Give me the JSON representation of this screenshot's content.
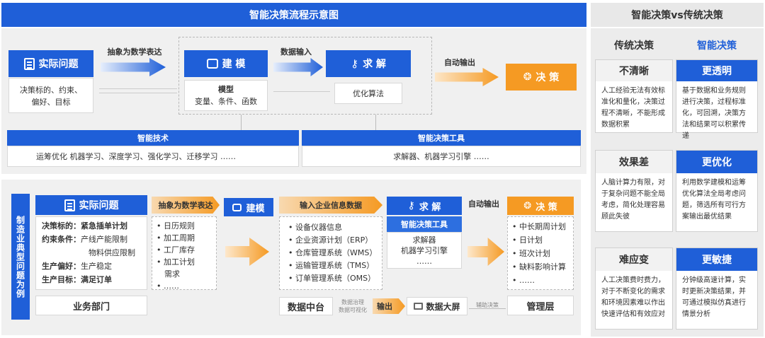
{
  "top": {
    "title": "智能决策流程示意图",
    "problem": "实际问题",
    "problem_desc": [
      "决策标的、约束、",
      "偏好、目标"
    ],
    "abstract": "抽象为数学表达",
    "model": "建 模",
    "model_title": "模型",
    "model_desc": "变量、条件、函数",
    "input": "数据输入",
    "solve": "求 解",
    "solve_desc": "优化算法",
    "output": "自动输出",
    "decide": "决 策",
    "tech_title": "智能技术",
    "tech_desc": "运筹优化  机器学习、深度学习、强化学习、迁移学习  ……",
    "tool_title": "智能决策工具",
    "tool_desc": "求解器、机器学习引擎  ……"
  },
  "bottom": {
    "side": "制造业典型问题为例",
    "problem": "实际问题",
    "items": [
      {
        "k": "决策标的：",
        "v": "紧急插单计划"
      },
      {
        "k": "约束条件：",
        "v": "产线产能限制"
      },
      {
        "k": "",
        "v": "物料供应限制"
      },
      {
        "k": "生产偏好：",
        "v": "生产稳定"
      },
      {
        "k": "生产目标：",
        "v": "满足订单"
      }
    ],
    "dept": "业务部门",
    "abstract": "抽象为数学表达",
    "rules": [
      "日历规则",
      "加工周期",
      "工厂库存",
      "加工计划",
      "需求",
      "……"
    ],
    "model": "建模",
    "input": "输入企业信息数据",
    "systems": [
      "设备仪器信息",
      "企业资源计划（ERP）",
      "仓库管理系统（WMS）",
      "运输管理系统（TMS）",
      "订单管理系统（OMS）"
    ],
    "center": "数据中台",
    "gov1": "数据治理",
    "gov2": "数据可视化",
    "out": "输出",
    "screen": "数据大屏",
    "assist": "辅助决策",
    "solve": "求 解",
    "tool": "智能决策工具",
    "tool_items": [
      "求解器",
      "机器学习引擎",
      "……"
    ],
    "auto": "自动输出",
    "decide": "决 策",
    "plans": [
      "中长期周计划",
      "日计划",
      "班次计划",
      "缺料影响计算",
      "……"
    ],
    "mgmt": "管理层"
  },
  "right": {
    "title": "智能决策vs传统决策",
    "col1": "传统决策",
    "col2": "智能决策",
    "rows": [
      {
        "bad": "不清晰",
        "bad_desc": "人工经验无法有效标准化和量化，决策过程不清晰，不能形成数据积累",
        "good": "更透明",
        "good_desc": "基于数据和业务规则进行决策，过程标准化，可回溯，决策方法和结果可以积累传递"
      },
      {
        "bad": "效果差",
        "bad_desc": "人脑计算力有限，对于复杂问题不能全局考虑，简化处理容易顾此失彼",
        "good": "更优化",
        "good_desc": "利用数学建模和运筹优化算法全局考虑问题，筛选所有可行方案输出最优结果"
      },
      {
        "bad": "难应变",
        "bad_desc": "人工决策费时费力，对于不断变化的需求和环境因素难以作出快速评估和有效应对",
        "good": "更敏捷",
        "good_desc": "分钟级高速计算，实时更新决策结果，并可通过模拟仿真进行情景分析"
      }
    ]
  },
  "colors": {
    "blue": "#1f5fd8",
    "orange": "#f59a23"
  }
}
